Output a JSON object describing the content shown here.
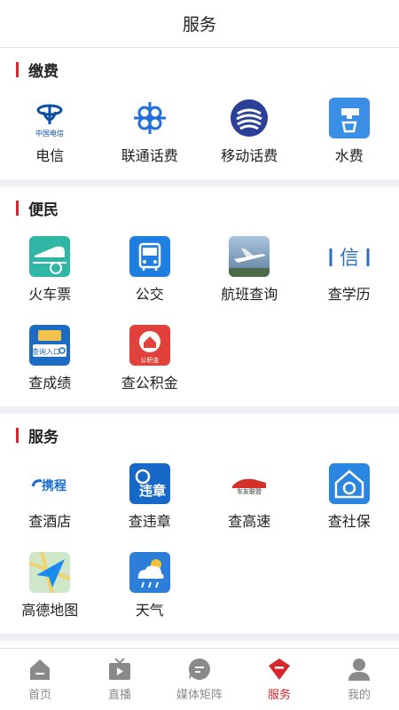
{
  "header": {
    "title": "服务"
  },
  "sections": [
    {
      "title": "缴费",
      "items": [
        {
          "label": "电信",
          "icon": "china-telecom-logo-icon",
          "logo_text": "中国电信"
        },
        {
          "label": "联通话费",
          "icon": "china-unicom-logo-icon"
        },
        {
          "label": "移动话费",
          "icon": "china-mobile-logo-icon"
        },
        {
          "label": "水费",
          "icon": "water-tap-icon"
        }
      ]
    },
    {
      "title": "便民",
      "items": [
        {
          "label": "火车票",
          "icon": "train-icon"
        },
        {
          "label": "公交",
          "icon": "bus-icon"
        },
        {
          "label": "航班查询",
          "icon": "airplane-photo-icon"
        },
        {
          "label": "查学历",
          "icon": "chsi-logo-icon",
          "logo_text": "信"
        },
        {
          "label": "查成绩",
          "icon": "score-query-icon",
          "logo_text": "查询入口"
        },
        {
          "label": "查公积金",
          "icon": "housing-fund-icon",
          "logo_text": "公积金"
        }
      ]
    },
    {
      "title": "服务",
      "items": [
        {
          "label": "查酒店",
          "icon": "ctrip-logo-icon",
          "logo_text": "携程"
        },
        {
          "label": "查违章",
          "icon": "traffic-violation-icon",
          "logo_text": "违章"
        },
        {
          "label": "查高速",
          "icon": "highway-car-icon",
          "logo_text": "车友联盟"
        },
        {
          "label": "查社保",
          "icon": "social-security-home-icon"
        },
        {
          "label": "高德地图",
          "icon": "amap-navigation-icon"
        },
        {
          "label": "天气",
          "icon": "weather-cloud-icon"
        }
      ]
    }
  ],
  "tabbar": {
    "items": [
      {
        "label": "首页",
        "icon": "home-icon",
        "active": false
      },
      {
        "label": "直播",
        "icon": "tv-icon",
        "active": false
      },
      {
        "label": "媒体矩阵",
        "icon": "chat-bubble-icon",
        "active": false
      },
      {
        "label": "服务",
        "icon": "service-shield-icon",
        "active": true
      },
      {
        "label": "我的",
        "icon": "user-icon",
        "active": false
      }
    ]
  },
  "colors": {
    "accent": "#d9262d",
    "tab_inactive": "#8a8a8a",
    "divider": "#eef0f6"
  }
}
